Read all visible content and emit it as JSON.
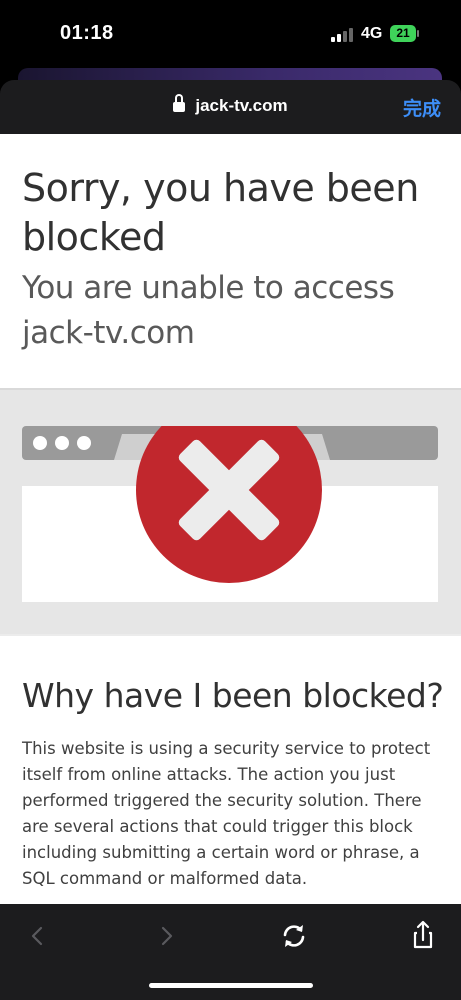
{
  "status_bar": {
    "time": "01:18",
    "network": "4G",
    "battery": "21"
  },
  "browser": {
    "url": "jack-tv.com",
    "done_label": "完成"
  },
  "page": {
    "title": "Sorry, you have been blocked",
    "subtitle": "You are unable to access jack-tv.com",
    "why_heading": "Why have I been blocked?",
    "why_body": "This website is using a security service to protect itself from online attacks. The action you just performed triggered the security solution. There are several actions that could trigger this block including submitting a certain word or phrase, a SQL command or malformed data."
  },
  "toolbar": {
    "icons": [
      "back-icon",
      "forward-icon",
      "reload-icon",
      "share-icon"
    ]
  },
  "colors": {
    "accent": "#3d8ef7",
    "error_red": "#c1272d",
    "battery_green": "#3fd35a"
  }
}
